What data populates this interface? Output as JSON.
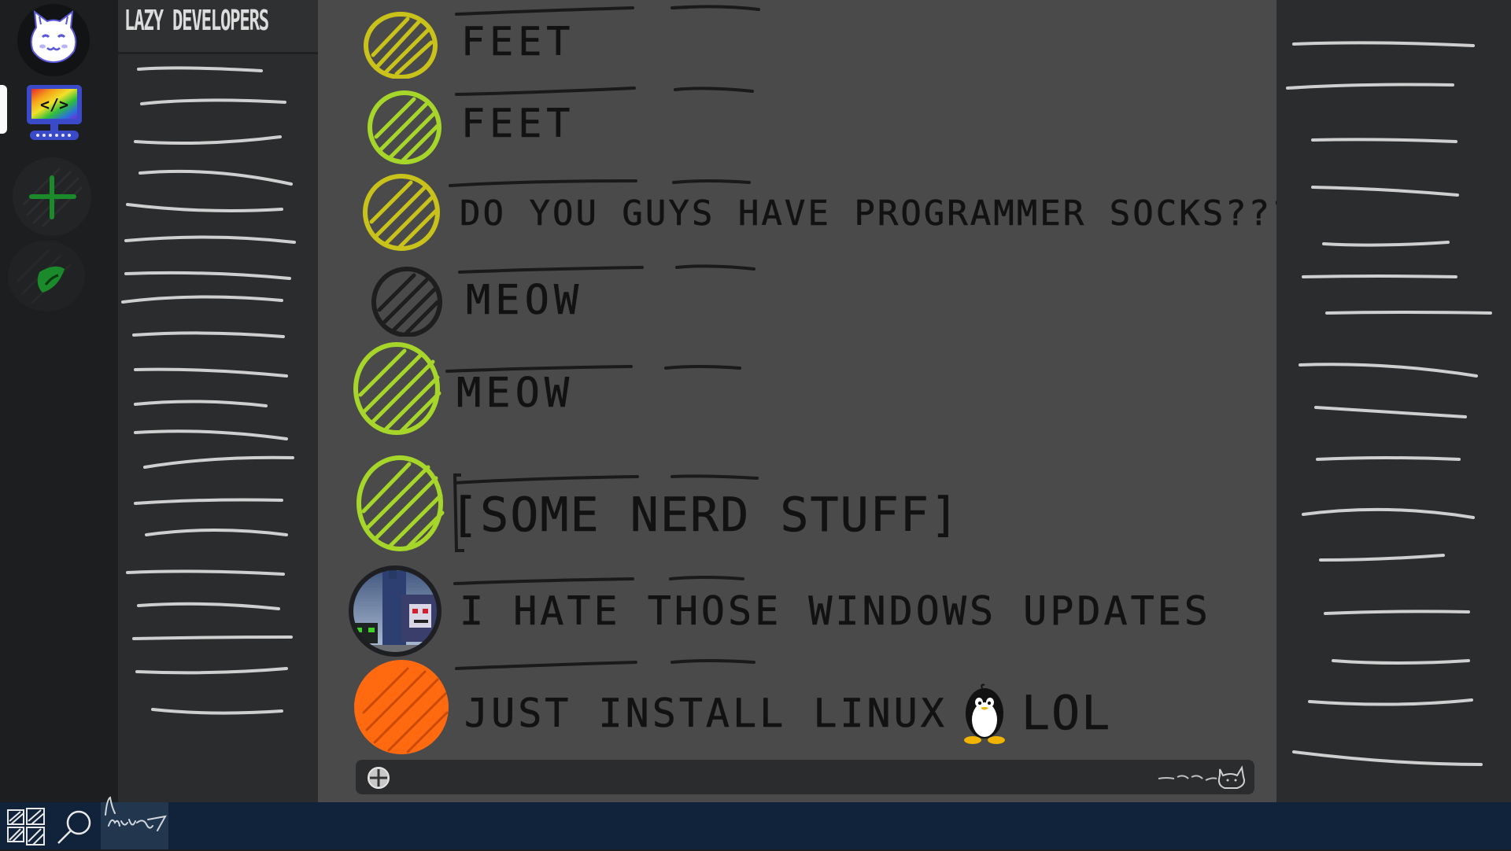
{
  "server": {
    "name": "LAZY DEVELOPERS"
  },
  "servers": [
    {
      "id": "home",
      "icon": "cat-face-icon"
    },
    {
      "id": "lazy-developers",
      "icon": "code-monitor-icon",
      "active": true
    },
    {
      "id": "add-server",
      "icon": "plus-icon"
    },
    {
      "id": "explore",
      "icon": "compass-icon"
    }
  ],
  "messages": [
    {
      "text": "FEET",
      "avatar_color": "#c8c21a"
    },
    {
      "text": "FEET",
      "avatar_color": "#a6d62a"
    },
    {
      "text": "DO YOU GUYS HAVE PROGRAMMER SOCKS???",
      "avatar_color": "#c8c21a"
    },
    {
      "text": "MEOW",
      "avatar_color": "#222222"
    },
    {
      "text": "MEOW",
      "avatar_color": "#a6d62a"
    },
    {
      "text": "[SOME NERD STUFF]",
      "avatar_color": "#a6d62a"
    },
    {
      "text": "I HATE THOSE WINDOWS UPDATES",
      "avatar_color": "pixel-art"
    },
    {
      "text": "JUST INSTALL LINUX",
      "suffix": "LOL",
      "emoji": "tux-penguin-icon",
      "avatar_color": "#ff6a10"
    }
  ],
  "composer": {
    "placeholder": "",
    "signature": "nyan-cat-icon"
  },
  "taskbar": {
    "start_icon": "windows-scribble-icon",
    "search_icon": "magnifier-icon",
    "pinned_app_icon": "nyan-signature-icon"
  },
  "colors": {
    "chat_bg": "#4a4a4a",
    "sidebar_bg": "#2a2c2d",
    "rail_bg": "#1c1e1f",
    "taskbar_bg": "#10233a",
    "accent_green": "#1a8a2a",
    "orange": "#ff6a10"
  }
}
